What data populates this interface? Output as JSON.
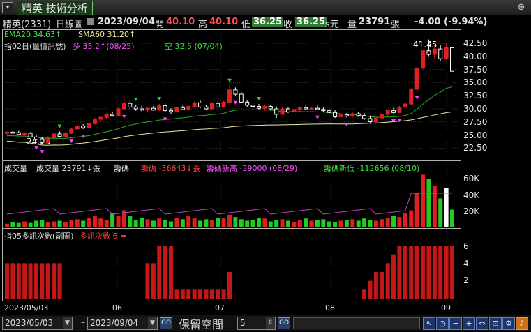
{
  "window": {
    "tab_title": "精英 技術分析"
  },
  "info": {
    "stock": "精英(2331)",
    "period": "日線圖",
    "date": "2023/09/04",
    "open_label": "開",
    "open": "40.10",
    "high_label": "高",
    "high": "40.10",
    "low_label": "低",
    "low": "36.25",
    "close_label": "收",
    "close": "36.25",
    "close_unit": "s元",
    "vol_label": "量",
    "vol": "23791",
    "vol_unit": "張",
    "change": "-4.00 (-9.94%)"
  },
  "price_panel": {
    "ema": "EMA20 34.63↑",
    "sma": "SMA60 31.20↑",
    "indicator": "指02日(量價訊號)",
    "long": "多 35.2↑(08/25)",
    "short": "空 32.5  (07/04)",
    "high_mark": "41.45",
    "low_mark": "24.25",
    "axis": [
      "42.50",
      "40.00",
      "37.50",
      "35.00",
      "32.50",
      "30.00",
      "27.50",
      "25.00",
      "22.50"
    ]
  },
  "volume_panel": {
    "title": "成交量",
    "vol": "成交量 23791↓張",
    "chip": "籌碼",
    "chip_val": "籌碼 -36643↓張",
    "chip_high": "籌碼新高 -29000  (08/29)",
    "chip_low": "籌碼新低 -112656  (08/10)",
    "axis": [
      "60K",
      "40K",
      "20K"
    ]
  },
  "count_panel": {
    "title": "指05多訊次數(副圖)",
    "count": "多訊次數 6 =",
    "axis": [
      "6",
      "4",
      "2"
    ]
  },
  "time_axis": {
    "start": "2023/05/03",
    "m6": "06",
    "m7": "07",
    "m8": "08",
    "m9": "09"
  },
  "bottom": {
    "from": "2023/05/03",
    "tilde": "~",
    "to": "2023/09/04",
    "go": "GO",
    "reserve": "保留空間",
    "reserve_val": "5"
  },
  "colors": {
    "up": "#e02020",
    "down": "#ffffff",
    "ema": "#2eaa2e",
    "sma": "#e8e8a0",
    "long": "#ff40ff",
    "short": "#2ed12e",
    "vol_green": "#22cc22"
  },
  "icons": [
    "arrow-up-left-icon",
    "clock-icon",
    "minus-icon",
    "plus-icon",
    "expand-icon",
    "target-icon",
    "settings-icon",
    "bell-icon"
  ],
  "chart_data": {
    "type": "candlestick",
    "ylim": [
      22,
      43
    ],
    "candles": [
      [
        26.1,
        26.4,
        25.9,
        26.3
      ],
      [
        26.3,
        26.6,
        26.0,
        26.2
      ],
      [
        26.2,
        26.5,
        25.8,
        25.9
      ],
      [
        25.9,
        26.3,
        25.6,
        26.1
      ],
      [
        26.1,
        26.3,
        25.4,
        25.5
      ],
      [
        25.5,
        25.8,
        24.9,
        25.1
      ],
      [
        25.1,
        25.5,
        24.25,
        24.6
      ],
      [
        24.6,
        25.6,
        24.5,
        25.4
      ],
      [
        25.4,
        26.2,
        25.2,
        26.0
      ],
      [
        26.0,
        26.4,
        25.4,
        25.6
      ],
      [
        25.6,
        26.3,
        25.3,
        26.1
      ],
      [
        26.1,
        27.0,
        26.0,
        26.8
      ],
      [
        26.8,
        27.5,
        26.6,
        27.3
      ],
      [
        27.3,
        27.6,
        26.8,
        27.0
      ],
      [
        27.0,
        27.9,
        26.8,
        27.7
      ],
      [
        27.7,
        28.6,
        27.5,
        28.4
      ],
      [
        28.4,
        28.9,
        28.0,
        28.7
      ],
      [
        28.7,
        29.4,
        28.4,
        29.2
      ],
      [
        29.2,
        29.6,
        28.8,
        29.0
      ],
      [
        29.0,
        30.3,
        28.9,
        30.1
      ],
      [
        30.1,
        31.9,
        30.0,
        31.0
      ],
      [
        31.0,
        31.4,
        30.1,
        30.4
      ],
      [
        30.4,
        30.8,
        29.8,
        30.1
      ],
      [
        30.1,
        30.6,
        29.7,
        29.9
      ],
      [
        29.9,
        30.4,
        29.5,
        30.2
      ],
      [
        30.2,
        30.6,
        29.8,
        29.9
      ],
      [
        29.9,
        30.9,
        29.8,
        30.6
      ],
      [
        30.6,
        31.0,
        29.6,
        29.8
      ],
      [
        29.8,
        30.2,
        29.3,
        29.6
      ],
      [
        29.6,
        30.5,
        29.5,
        30.3
      ],
      [
        30.3,
        30.6,
        29.9,
        30.0
      ],
      [
        30.0,
        30.6,
        29.9,
        30.5
      ],
      [
        30.5,
        31.3,
        30.3,
        31.1
      ],
      [
        31.1,
        31.5,
        30.2,
        30.4
      ],
      [
        30.4,
        30.8,
        29.9,
        30.1
      ],
      [
        30.1,
        31.2,
        30.0,
        31.0
      ],
      [
        31.0,
        31.3,
        30.2,
        30.4
      ],
      [
        30.4,
        31.4,
        30.3,
        31.2
      ],
      [
        31.2,
        33.9,
        30.8,
        33.2
      ],
      [
        33.2,
        33.6,
        32.3,
        32.5
      ],
      [
        32.5,
        32.9,
        31.0,
        31.2
      ],
      [
        31.2,
        31.5,
        30.4,
        30.7
      ],
      [
        30.7,
        31.0,
        30.2,
        30.5
      ],
      [
        30.5,
        30.9,
        30.0,
        30.2
      ],
      [
        30.2,
        30.7,
        29.8,
        30.5
      ],
      [
        30.5,
        30.8,
        30.0,
        30.1
      ],
      [
        30.1,
        30.5,
        28.6,
        29.2
      ],
      [
        29.2,
        30.3,
        29.1,
        30.1
      ],
      [
        30.1,
        30.4,
        29.4,
        29.6
      ],
      [
        29.6,
        30.2,
        29.4,
        30.0
      ],
      [
        30.0,
        30.5,
        29.7,
        30.3
      ],
      [
        30.3,
        30.8,
        29.9,
        30.1
      ],
      [
        30.1,
        30.4,
        29.9,
        30.2
      ],
      [
        30.2,
        30.7,
        29.9,
        30.0
      ],
      [
        30.0,
        30.4,
        29.6,
        29.8
      ],
      [
        29.8,
        30.1,
        29.3,
        29.5
      ],
      [
        29.5,
        29.9,
        28.6,
        28.8
      ],
      [
        28.8,
        29.3,
        28.5,
        29.1
      ],
      [
        29.1,
        29.4,
        28.7,
        28.9
      ],
      [
        28.9,
        29.5,
        28.7,
        29.3
      ],
      [
        29.3,
        29.6,
        28.8,
        29.0
      ],
      [
        29.0,
        29.4,
        28.3,
        28.5
      ],
      [
        28.5,
        29.0,
        27.8,
        28.0
      ],
      [
        28.0,
        28.8,
        27.6,
        28.6
      ],
      [
        28.6,
        29.4,
        28.4,
        29.2
      ],
      [
        29.2,
        30.0,
        29.0,
        29.8
      ],
      [
        29.8,
        30.4,
        29.3,
        29.5
      ],
      [
        29.5,
        30.6,
        29.4,
        30.4
      ],
      [
        30.4,
        31.2,
        30.1,
        30.9
      ],
      [
        30.9,
        33.5,
        30.7,
        33.3
      ],
      [
        33.3,
        37.0,
        33.1,
        36.8
      ],
      [
        36.8,
        39.8,
        36.5,
        39.6
      ],
      [
        39.6,
        41.45,
        38.6,
        39.0
      ],
      [
        39.0,
        40.6,
        38.2,
        39.9
      ],
      [
        39.9,
        40.6,
        38.0,
        38.3
      ],
      [
        38.3,
        40.9,
        38.1,
        40.1
      ],
      [
        40.1,
        40.1,
        36.25,
        36.25
      ]
    ],
    "volume": [
      4,
      6,
      5,
      7,
      5,
      8,
      9,
      6,
      7,
      8,
      6,
      9,
      10,
      8,
      12,
      14,
      11,
      9,
      18,
      15,
      22,
      14,
      9,
      12,
      10,
      8,
      11,
      9,
      7,
      12,
      10,
      14,
      11,
      8,
      10,
      9,
      12,
      11,
      16,
      13,
      10,
      8,
      9,
      12,
      11,
      7,
      9,
      10,
      8,
      6,
      9,
      11,
      8,
      9,
      10,
      7,
      6,
      8,
      9,
      10,
      8,
      11,
      9,
      8,
      10,
      12,
      15,
      13,
      18,
      22,
      45,
      70,
      64,
      55,
      38,
      52,
      23
    ]
  }
}
